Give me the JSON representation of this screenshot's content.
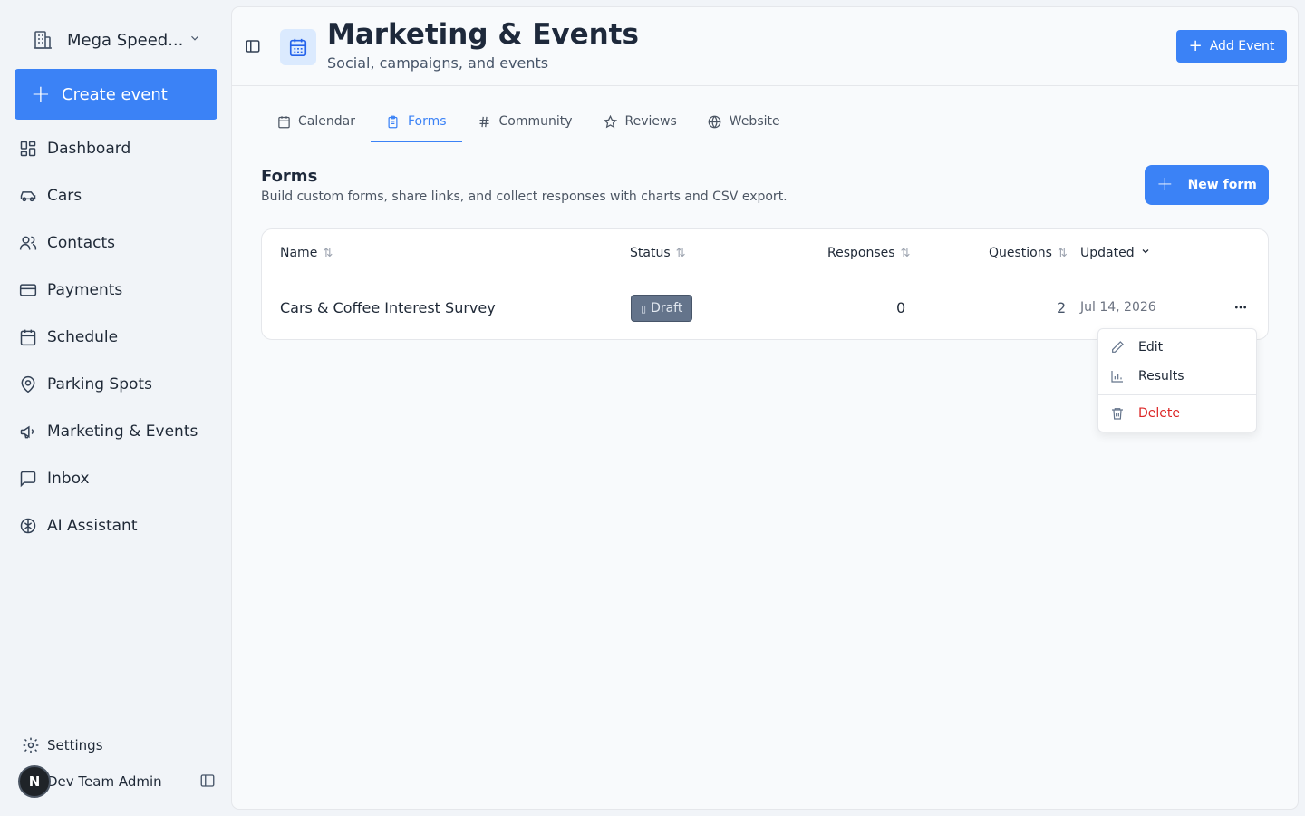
{
  "sidebar": {
    "org_name": "Mega Speed...",
    "create_label": "Create event",
    "items": [
      {
        "label": "Dashboard",
        "icon": "dashboard-icon"
      },
      {
        "label": "Cars",
        "icon": "car-icon"
      },
      {
        "label": "Contacts",
        "icon": "users-icon"
      },
      {
        "label": "Payments",
        "icon": "credit-card-icon"
      },
      {
        "label": "Schedule",
        "icon": "calendar-icon"
      },
      {
        "label": "Parking Spots",
        "icon": "map-pin-icon"
      },
      {
        "label": "Marketing & Events",
        "icon": "megaphone-icon"
      },
      {
        "label": "Inbox",
        "icon": "message-icon"
      },
      {
        "label": "AI Assistant",
        "icon": "brain-icon"
      }
    ],
    "settings_label": "Settings",
    "user_initial": "N",
    "user_name": "Dev Team Admin"
  },
  "header": {
    "title": "Marketing & Events",
    "subtitle": "Social, campaigns, and events",
    "add_event_label": "Add Event"
  },
  "tabs": [
    {
      "label": "Calendar",
      "icon": "calendar-icon"
    },
    {
      "label": "Forms",
      "icon": "clipboard-icon",
      "active": true
    },
    {
      "label": "Community",
      "icon": "hash-icon"
    },
    {
      "label": "Reviews",
      "icon": "star-icon"
    },
    {
      "label": "Website",
      "icon": "globe-icon"
    }
  ],
  "forms": {
    "title": "Forms",
    "description": "Build custom forms, share links, and collect responses with charts and CSV export.",
    "new_form_label": "New form",
    "columns": {
      "name": "Name",
      "status": "Status",
      "responses": "Responses",
      "questions": "Questions",
      "updated": "Updated"
    },
    "rows": [
      {
        "name": "Cars & Coffee Interest Survey",
        "status": "Draft",
        "responses": "0",
        "questions": "2",
        "updated": "Jul 14, 2026"
      }
    ]
  },
  "menu": {
    "edit": "Edit",
    "results": "Results",
    "delete": "Delete"
  },
  "colors": {
    "accent": "#3b82f6",
    "danger": "#dc2626",
    "draft_badge": "#64748b"
  }
}
